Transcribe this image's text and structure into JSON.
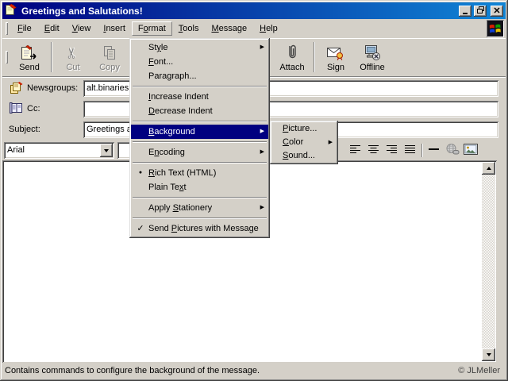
{
  "window": {
    "title": "Greetings and Salutations!"
  },
  "menu_bar": {
    "items": [
      {
        "label": "File",
        "accel": 0
      },
      {
        "label": "Edit",
        "accel": 0
      },
      {
        "label": "View",
        "accel": 0
      },
      {
        "label": "Insert",
        "accel": 0
      },
      {
        "label": "Format",
        "accel": 1,
        "open": true
      },
      {
        "label": "Tools",
        "accel": 0
      },
      {
        "label": "Message",
        "accel": 0
      },
      {
        "label": "Help",
        "accel": 0
      }
    ]
  },
  "toolbar": {
    "buttons": [
      {
        "label": "Send",
        "icon": "send-icon",
        "disabled": false,
        "divider_after": true
      },
      {
        "label": "Cut",
        "icon": "cut-icon",
        "disabled": true
      },
      {
        "label": "Copy",
        "icon": "copy-icon",
        "disabled": true,
        "spacer_after": true
      },
      {
        "label": "Attach",
        "icon": "attach-icon",
        "disabled": false,
        "divider_after": true
      },
      {
        "label": "Sign",
        "icon": "sign-icon",
        "disabled": false
      },
      {
        "label": "Offline",
        "icon": "offline-icon",
        "disabled": false
      }
    ]
  },
  "fields": {
    "rows": [
      {
        "label": "Newsgroups:",
        "icon": "newsgroups-icon",
        "value": "alt.binaries"
      },
      {
        "label": "Cc:",
        "icon": "address-book-icon",
        "value": ""
      },
      {
        "label": "Subject:",
        "icon": null,
        "value": "Greetings a"
      }
    ]
  },
  "format_bar": {
    "font_name": "Arial",
    "buttons": [
      {
        "icon": "align-left-icon",
        "disabled": false
      },
      {
        "icon": "align-center-icon",
        "disabled": false
      },
      {
        "icon": "align-right-icon",
        "disabled": false
      },
      {
        "icon": "justify-icon",
        "disabled": false
      },
      {
        "divider": true
      },
      {
        "icon": "horizontal-line-icon",
        "disabled": false
      },
      {
        "icon": "insert-link-icon",
        "disabled": true
      },
      {
        "icon": "insert-picture-icon",
        "disabled": false
      }
    ]
  },
  "format_menu": {
    "items": [
      {
        "label": "Style",
        "accel": 2,
        "arrow": true
      },
      {
        "label": "Font...",
        "accel": 0
      },
      {
        "label": "Paragraph...",
        "accel": 4
      },
      {
        "separator": true
      },
      {
        "label": "Increase Indent",
        "accel": 0
      },
      {
        "label": "Decrease Indent",
        "accel": 0
      },
      {
        "separator": true
      },
      {
        "label": "Background",
        "accel": 0,
        "arrow": true,
        "highlighted": true
      },
      {
        "separator": true
      },
      {
        "label": "Encoding",
        "accel": 1,
        "arrow": true
      },
      {
        "separator": true
      },
      {
        "label": "Rich Text (HTML)",
        "accel": 0,
        "mark": "bullet"
      },
      {
        "label": "Plain Text",
        "accel": 8
      },
      {
        "separator": true
      },
      {
        "label": "Apply Stationery",
        "accel": 6,
        "arrow": true
      },
      {
        "separator": true
      },
      {
        "label": "Send Pictures with Message",
        "accel": 5,
        "mark": "check"
      }
    ]
  },
  "background_submenu": {
    "items": [
      {
        "label": "Picture...",
        "accel": 0
      },
      {
        "label": "Color",
        "accel": 0,
        "arrow": true
      },
      {
        "label": "Sound...",
        "accel": 0
      }
    ]
  },
  "status_bar": {
    "text": "Contains commands to configure the background of the message."
  },
  "credit": "© JLMeller",
  "colors": {
    "titlebar_left": "#000080",
    "titlebar_right": "#1085d6",
    "menu_highlight": "#000080",
    "face": "#d4d0c8"
  }
}
